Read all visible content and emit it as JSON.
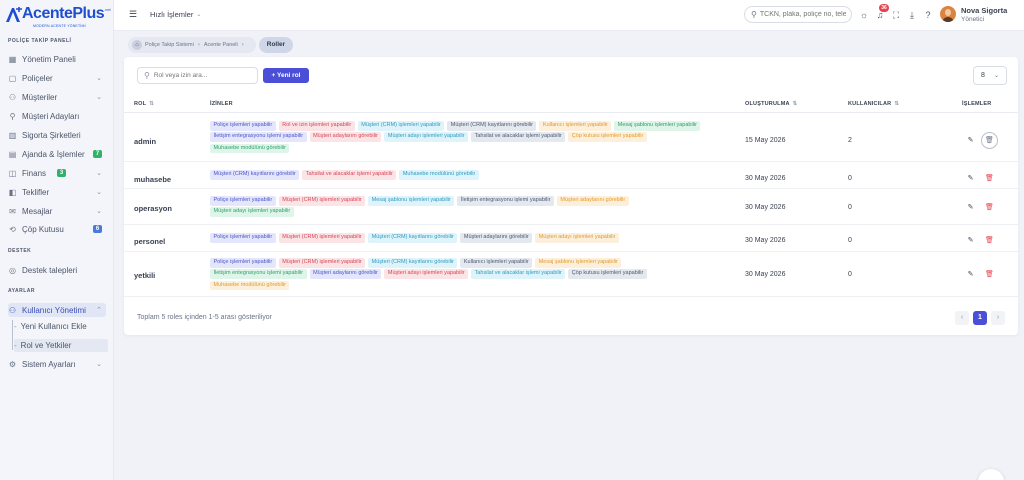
{
  "brand": {
    "name": "AcentePlus",
    "name_a": "Acente",
    "name_b": "Plus",
    "sub": "MODERN ACENTE YÖNETİMİ",
    "tld": ".net"
  },
  "sidebar": {
    "section_policy": "POLİÇE TAKİP PANELİ",
    "section_support": "DESTEK",
    "section_settings": "AYARLAR",
    "items": [
      {
        "label": "Yönetim Paneli",
        "icon": "grid-icon"
      },
      {
        "label": "Poliçeler",
        "icon": "document-icon"
      },
      {
        "label": "Müşteriler",
        "icon": "users-icon"
      },
      {
        "label": "Müşteri Adayları",
        "icon": "user-plus-icon"
      },
      {
        "label": "Sigorta Şirketleri",
        "icon": "building-icon"
      },
      {
        "label": "Ajanda & İşlemler",
        "icon": "calendar-icon",
        "badge": "7"
      },
      {
        "label": "Finans",
        "icon": "wallet-icon",
        "badge": "3"
      },
      {
        "label": "Teklifler",
        "icon": "offer-icon"
      },
      {
        "label": "Mesajlar",
        "icon": "message-icon"
      },
      {
        "label": "Çöp Kutusu",
        "icon": "trash-icon",
        "badge": "6"
      }
    ],
    "support_item": "Destek talepleri",
    "user_mgmt": "Kullanıcı Yönetimi",
    "sub_items": [
      "Yeni Kullanıcı Ekle",
      "Rol ve Yetkiler"
    ],
    "system_settings": "Sistem Ayarları",
    "colors": {
      "badge_green": "#2fb36b",
      "badge_blue": "#4b7bd8"
    }
  },
  "topbar": {
    "quick": "Hızlı İşlemler",
    "search_placeholder": "TCKN, plaka, poliçe no, tele",
    "notif_count": "36",
    "user_name": "Nova Sigorta",
    "user_role": "Yönetici"
  },
  "breadcrumb": [
    "Poliçe Takip Sistemi",
    "Acente Paneli",
    "Roller"
  ],
  "toolbar": {
    "search_placeholder": "Rol veya izin ara...",
    "new_role": "+ Yeni rol",
    "per_page": "8"
  },
  "table": {
    "headers": {
      "role": "ROL",
      "perms": "İZİNLER",
      "created": "OLUŞTURULMA",
      "users": "KULLANICILAR",
      "actions": "İŞLEMLER"
    },
    "rows": [
      {
        "role": "admin",
        "date": "15 May 2026",
        "users": "2",
        "perms": [
          [
            "Poliçe işlemleri yapabilir",
            0
          ],
          [
            "Rol ve izin işlemleri yapabilir",
            1
          ],
          [
            "Müşteri (CRM) işlemleri yapabilir",
            2
          ],
          [
            "Müşteri (CRM) kayıtlarını görebilir",
            3
          ],
          [
            "Kullanıcı işlemleri yapabilir",
            4
          ],
          [
            "Mesaj şablonu işlemleri yapabilir",
            5
          ],
          [
            "İletişim entegrasyonu işlemi yapabilir",
            0
          ],
          [
            "Müşteri adaylarını görebilir",
            1
          ],
          [
            "Müşteri adayı işlemleri yapabilir",
            2
          ],
          [
            "Tahsilat ve alacaklar işlemi yapabilir",
            3
          ],
          [
            "Çöp kutusu işlemleri yapabilir",
            4
          ],
          [
            "Muhasebe modülünü görebilir",
            5
          ]
        ]
      },
      {
        "role": "muhasebe",
        "date": "30 May 2026",
        "users": "0",
        "perms": [
          [
            "Müşteri (CRM) kayıtlarını görebilir",
            0
          ],
          [
            "Tahsilat ve alacaklar işlemi yapabilir",
            1
          ],
          [
            "Muhasebe modülünü görebilir",
            2
          ]
        ]
      },
      {
        "role": "operasyon",
        "date": "30 May 2026",
        "users": "0",
        "perms": [
          [
            "Poliçe işlemleri yapabilir",
            0
          ],
          [
            "Müşteri (CRM) işlemleri yapabilir",
            1
          ],
          [
            "Mesaj şablonu işlemleri yapabilir",
            2
          ],
          [
            "İletişim entegrasyonu işlemi yapabilir",
            3
          ],
          [
            "Müşteri adaylarını görebilir",
            4
          ],
          [
            "Müşteri adayı işlemleri yapabilir",
            5
          ]
        ]
      },
      {
        "role": "personel",
        "date": "30 May 2026",
        "users": "0",
        "perms": [
          [
            "Poliçe işlemleri yapabilir",
            0
          ],
          [
            "Müşteri (CRM) işlemleri yapabilir",
            1
          ],
          [
            "Müşteri (CRM) kayıtlarını görebilir",
            2
          ],
          [
            "Müşteri adaylarını görebilir",
            3
          ],
          [
            "Müşteri adayı işlemleri yapabilir",
            4
          ]
        ]
      },
      {
        "role": "yetkili",
        "date": "30 May 2026",
        "users": "0",
        "perms": [
          [
            "Poliçe işlemleri yapabilir",
            0
          ],
          [
            "Müşteri (CRM) işlemleri yapabilir",
            1
          ],
          [
            "Müşteri (CRM) kayıtlarını görebilir",
            2
          ],
          [
            "Kullanıcı işlemleri yapabilir",
            3
          ],
          [
            "Mesaj şablonu işlemleri yapabilir",
            4
          ],
          [
            "İletişim entegrasyonu işlemi yapabilir",
            5
          ],
          [
            "Müşteri adaylarını görebilir",
            0
          ],
          [
            "Müşteri adayı işlemleri yapabilir",
            1
          ],
          [
            "Tahsilat ve alacaklar işlemi yapabilir",
            2
          ],
          [
            "Çöp kutusu işlemleri yapabilir",
            3
          ],
          [
            "Muhasebe modülünü görebilir",
            4
          ]
        ]
      }
    ]
  },
  "footer": {
    "summary": "Toplam 5 roles içinden 1-5 arası gösteriliyor",
    "page": "1"
  }
}
